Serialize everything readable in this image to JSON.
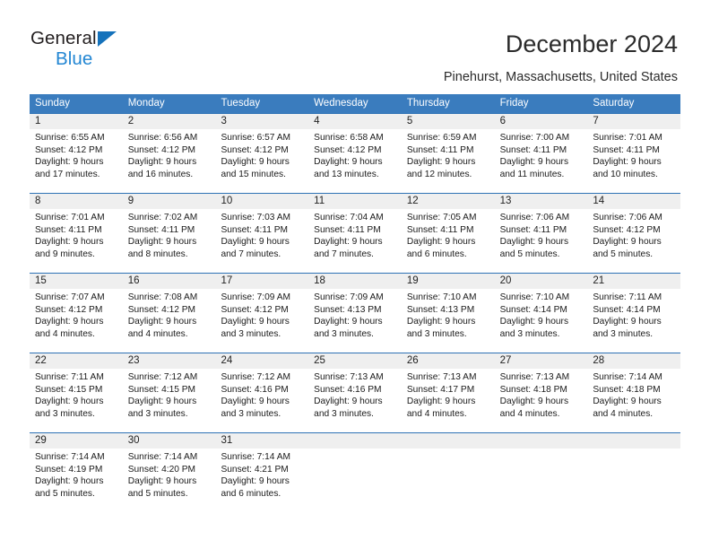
{
  "brand": {
    "name_part1": "General",
    "name_part2": "Blue",
    "triangle_color": "#1572bb",
    "blue_color": "#2286d3"
  },
  "header": {
    "title": "December 2024",
    "location": "Pinehurst, Massachusetts, United States"
  },
  "theme": {
    "header_blue": "#3a7cbe",
    "separator_blue": "#2e72b5",
    "daynum_band": "#efefef"
  },
  "weekdays": [
    "Sunday",
    "Monday",
    "Tuesday",
    "Wednesday",
    "Thursday",
    "Friday",
    "Saturday"
  ],
  "weeks": [
    [
      {
        "day": "1",
        "sunrise": "Sunrise: 6:55 AM",
        "sunset": "Sunset: 4:12 PM",
        "daylight1": "Daylight: 9 hours",
        "daylight2": "and 17 minutes."
      },
      {
        "day": "2",
        "sunrise": "Sunrise: 6:56 AM",
        "sunset": "Sunset: 4:12 PM",
        "daylight1": "Daylight: 9 hours",
        "daylight2": "and 16 minutes."
      },
      {
        "day": "3",
        "sunrise": "Sunrise: 6:57 AM",
        "sunset": "Sunset: 4:12 PM",
        "daylight1": "Daylight: 9 hours",
        "daylight2": "and 15 minutes."
      },
      {
        "day": "4",
        "sunrise": "Sunrise: 6:58 AM",
        "sunset": "Sunset: 4:12 PM",
        "daylight1": "Daylight: 9 hours",
        "daylight2": "and 13 minutes."
      },
      {
        "day": "5",
        "sunrise": "Sunrise: 6:59 AM",
        "sunset": "Sunset: 4:11 PM",
        "daylight1": "Daylight: 9 hours",
        "daylight2": "and 12 minutes."
      },
      {
        "day": "6",
        "sunrise": "Sunrise: 7:00 AM",
        "sunset": "Sunset: 4:11 PM",
        "daylight1": "Daylight: 9 hours",
        "daylight2": "and 11 minutes."
      },
      {
        "day": "7",
        "sunrise": "Sunrise: 7:01 AM",
        "sunset": "Sunset: 4:11 PM",
        "daylight1": "Daylight: 9 hours",
        "daylight2": "and 10 minutes."
      }
    ],
    [
      {
        "day": "8",
        "sunrise": "Sunrise: 7:01 AM",
        "sunset": "Sunset: 4:11 PM",
        "daylight1": "Daylight: 9 hours",
        "daylight2": "and 9 minutes."
      },
      {
        "day": "9",
        "sunrise": "Sunrise: 7:02 AM",
        "sunset": "Sunset: 4:11 PM",
        "daylight1": "Daylight: 9 hours",
        "daylight2": "and 8 minutes."
      },
      {
        "day": "10",
        "sunrise": "Sunrise: 7:03 AM",
        "sunset": "Sunset: 4:11 PM",
        "daylight1": "Daylight: 9 hours",
        "daylight2": "and 7 minutes."
      },
      {
        "day": "11",
        "sunrise": "Sunrise: 7:04 AM",
        "sunset": "Sunset: 4:11 PM",
        "daylight1": "Daylight: 9 hours",
        "daylight2": "and 7 minutes."
      },
      {
        "day": "12",
        "sunrise": "Sunrise: 7:05 AM",
        "sunset": "Sunset: 4:11 PM",
        "daylight1": "Daylight: 9 hours",
        "daylight2": "and 6 minutes."
      },
      {
        "day": "13",
        "sunrise": "Sunrise: 7:06 AM",
        "sunset": "Sunset: 4:11 PM",
        "daylight1": "Daylight: 9 hours",
        "daylight2": "and 5 minutes."
      },
      {
        "day": "14",
        "sunrise": "Sunrise: 7:06 AM",
        "sunset": "Sunset: 4:12 PM",
        "daylight1": "Daylight: 9 hours",
        "daylight2": "and 5 minutes."
      }
    ],
    [
      {
        "day": "15",
        "sunrise": "Sunrise: 7:07 AM",
        "sunset": "Sunset: 4:12 PM",
        "daylight1": "Daylight: 9 hours",
        "daylight2": "and 4 minutes."
      },
      {
        "day": "16",
        "sunrise": "Sunrise: 7:08 AM",
        "sunset": "Sunset: 4:12 PM",
        "daylight1": "Daylight: 9 hours",
        "daylight2": "and 4 minutes."
      },
      {
        "day": "17",
        "sunrise": "Sunrise: 7:09 AM",
        "sunset": "Sunset: 4:12 PM",
        "daylight1": "Daylight: 9 hours",
        "daylight2": "and 3 minutes."
      },
      {
        "day": "18",
        "sunrise": "Sunrise: 7:09 AM",
        "sunset": "Sunset: 4:13 PM",
        "daylight1": "Daylight: 9 hours",
        "daylight2": "and 3 minutes."
      },
      {
        "day": "19",
        "sunrise": "Sunrise: 7:10 AM",
        "sunset": "Sunset: 4:13 PM",
        "daylight1": "Daylight: 9 hours",
        "daylight2": "and 3 minutes."
      },
      {
        "day": "20",
        "sunrise": "Sunrise: 7:10 AM",
        "sunset": "Sunset: 4:14 PM",
        "daylight1": "Daylight: 9 hours",
        "daylight2": "and 3 minutes."
      },
      {
        "day": "21",
        "sunrise": "Sunrise: 7:11 AM",
        "sunset": "Sunset: 4:14 PM",
        "daylight1": "Daylight: 9 hours",
        "daylight2": "and 3 minutes."
      }
    ],
    [
      {
        "day": "22",
        "sunrise": "Sunrise: 7:11 AM",
        "sunset": "Sunset: 4:15 PM",
        "daylight1": "Daylight: 9 hours",
        "daylight2": "and 3 minutes."
      },
      {
        "day": "23",
        "sunrise": "Sunrise: 7:12 AM",
        "sunset": "Sunset: 4:15 PM",
        "daylight1": "Daylight: 9 hours",
        "daylight2": "and 3 minutes."
      },
      {
        "day": "24",
        "sunrise": "Sunrise: 7:12 AM",
        "sunset": "Sunset: 4:16 PM",
        "daylight1": "Daylight: 9 hours",
        "daylight2": "and 3 minutes."
      },
      {
        "day": "25",
        "sunrise": "Sunrise: 7:13 AM",
        "sunset": "Sunset: 4:16 PM",
        "daylight1": "Daylight: 9 hours",
        "daylight2": "and 3 minutes."
      },
      {
        "day": "26",
        "sunrise": "Sunrise: 7:13 AM",
        "sunset": "Sunset: 4:17 PM",
        "daylight1": "Daylight: 9 hours",
        "daylight2": "and 4 minutes."
      },
      {
        "day": "27",
        "sunrise": "Sunrise: 7:13 AM",
        "sunset": "Sunset: 4:18 PM",
        "daylight1": "Daylight: 9 hours",
        "daylight2": "and 4 minutes."
      },
      {
        "day": "28",
        "sunrise": "Sunrise: 7:14 AM",
        "sunset": "Sunset: 4:18 PM",
        "daylight1": "Daylight: 9 hours",
        "daylight2": "and 4 minutes."
      }
    ],
    [
      {
        "day": "29",
        "sunrise": "Sunrise: 7:14 AM",
        "sunset": "Sunset: 4:19 PM",
        "daylight1": "Daylight: 9 hours",
        "daylight2": "and 5 minutes."
      },
      {
        "day": "30",
        "sunrise": "Sunrise: 7:14 AM",
        "sunset": "Sunset: 4:20 PM",
        "daylight1": "Daylight: 9 hours",
        "daylight2": "and 5 minutes."
      },
      {
        "day": "31",
        "sunrise": "Sunrise: 7:14 AM",
        "sunset": "Sunset: 4:21 PM",
        "daylight1": "Daylight: 9 hours",
        "daylight2": "and 6 minutes."
      },
      {
        "day": "",
        "sunrise": "",
        "sunset": "",
        "daylight1": "",
        "daylight2": ""
      },
      {
        "day": "",
        "sunrise": "",
        "sunset": "",
        "daylight1": "",
        "daylight2": ""
      },
      {
        "day": "",
        "sunrise": "",
        "sunset": "",
        "daylight1": "",
        "daylight2": ""
      },
      {
        "day": "",
        "sunrise": "",
        "sunset": "",
        "daylight1": "",
        "daylight2": ""
      }
    ]
  ]
}
